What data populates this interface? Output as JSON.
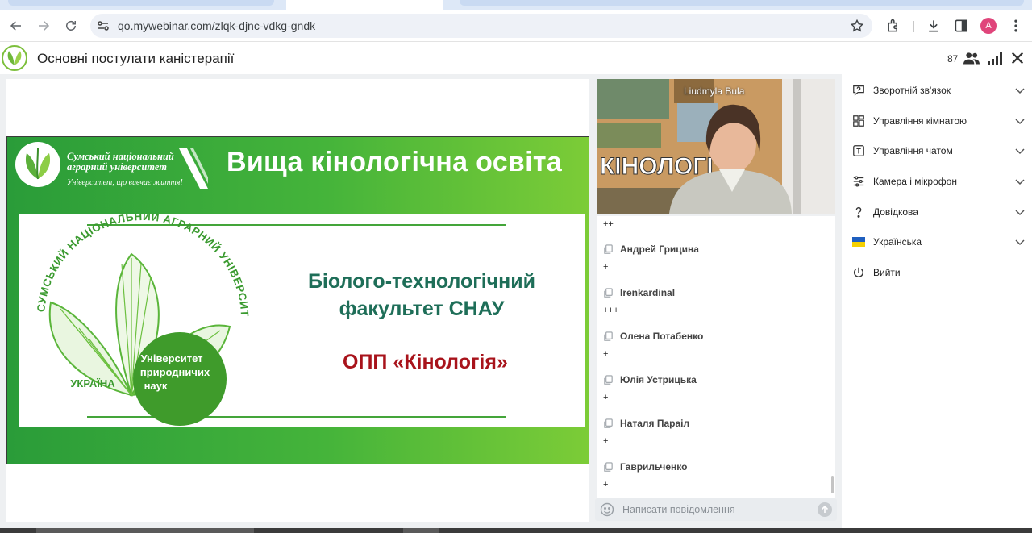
{
  "browser": {
    "url": "qo.mywebinar.com/zlqk-djnc-vdkg-gndk",
    "profile_initial": "A",
    "icons": [
      "back-icon",
      "forward-icon",
      "reload-icon",
      "site-settings-icon",
      "bookmark-star-icon",
      "extensions-icon",
      "download-icon",
      "side-panel-icon",
      "menu-dots-icon"
    ]
  },
  "header": {
    "title": "Основні постулати каністерапії",
    "participants_count": "87"
  },
  "slide": {
    "brand_name": "Сумський національний аграрний університет",
    "brand_motto": "Університет, що вивчає життя!",
    "heading": "Вища кінологічна освіта",
    "emblem_ring": "СУМСЬКИЙ НАЦІОНАЛЬНИЙ АГРАРНИЙ УНІВЕРСИТЕТ",
    "emblem_country": "УКРАЇНА",
    "emblem_tag_1": "Університет",
    "emblem_tag_2": "природничих",
    "emblem_tag_3": "наук",
    "faculty_1": "Біолого-технологічний",
    "faculty_2": "факультет СНАУ",
    "program": "ОПП «Кінологія»"
  },
  "video": {
    "speaker_name": "Liudmyla Bula",
    "background_text": "КІНОЛОГІ"
  },
  "chat": {
    "top_fragment": "++",
    "messages": [
      {
        "author": "Андрей Грицина",
        "text": "+"
      },
      {
        "author": "Irenkardinal",
        "text": "+++"
      },
      {
        "author": "Олена Потабенко",
        "text": "+"
      },
      {
        "author": "Юлія Устрицька",
        "text": "+"
      },
      {
        "author": "Наталя Параіл",
        "text": "+"
      },
      {
        "author": "Гаврильченко",
        "text": "+"
      }
    ],
    "composer_placeholder": "Написати повідомлення"
  },
  "side_menu": {
    "items": [
      {
        "label": "Зворотній зв'язок",
        "icon": "feedback-icon"
      },
      {
        "label": "Управління кімнатою",
        "icon": "room-layout-icon"
      },
      {
        "label": "Управління чатом",
        "icon": "chat-text-icon"
      },
      {
        "label": "Камера і мікрофон",
        "icon": "sliders-icon"
      },
      {
        "label": "Довідкова",
        "icon": "help-icon"
      },
      {
        "label": "Українська",
        "icon": "ukraine-flag-icon"
      },
      {
        "label": "Вийти",
        "icon": "power-icon"
      }
    ]
  },
  "colors": {
    "slide_green": "#45b43a",
    "faculty_teal": "#1e6e58",
    "program_red": "#a8131b",
    "flag_blue": "#1f5fbf",
    "flag_yellow": "#f6d000"
  }
}
